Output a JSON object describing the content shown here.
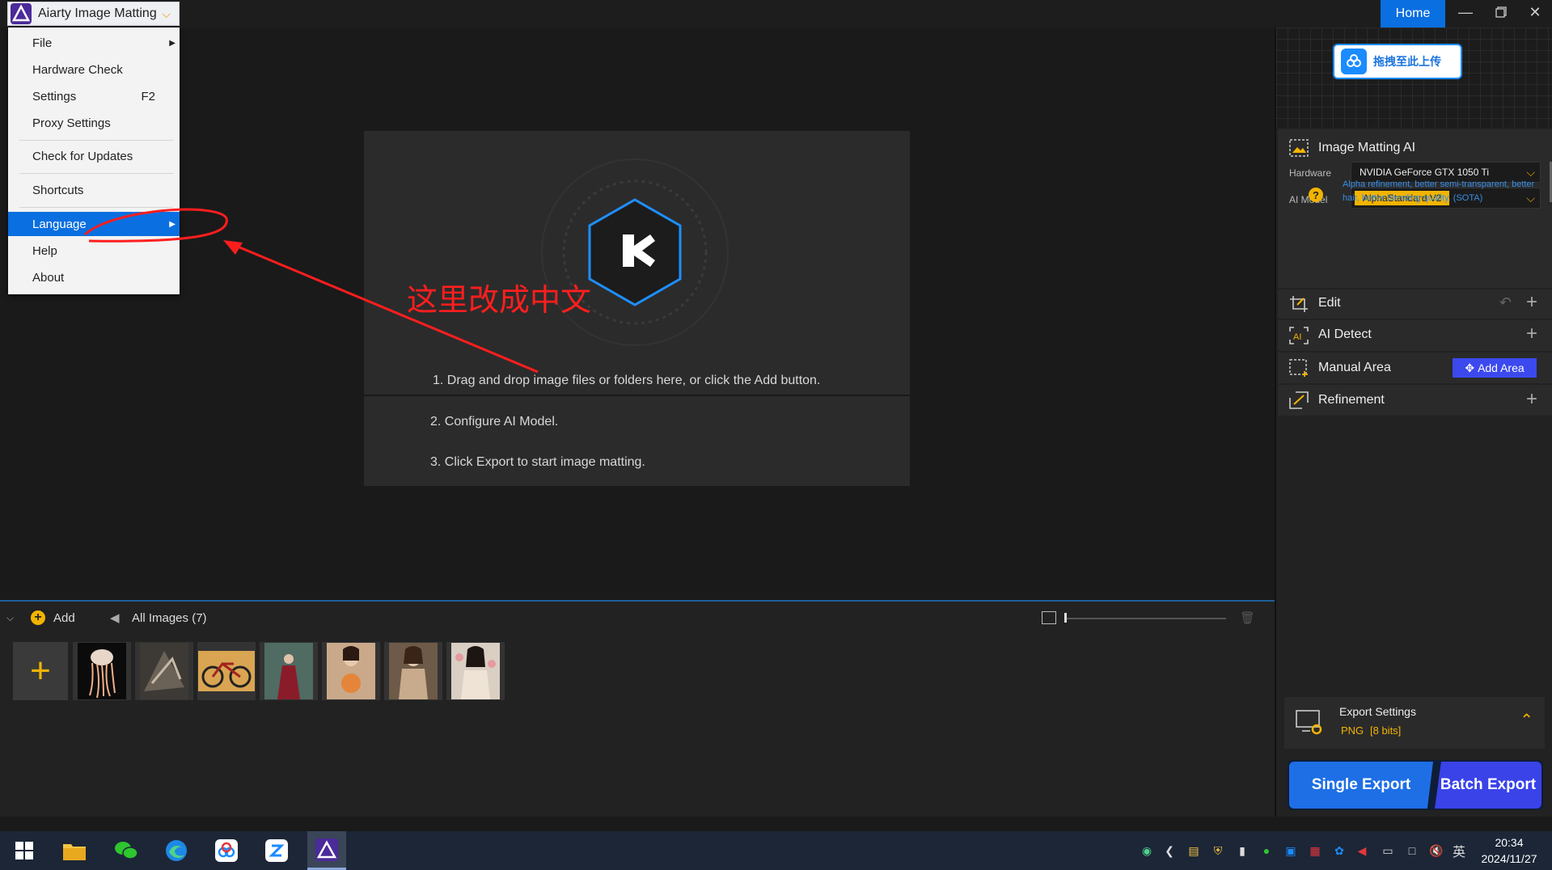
{
  "app": {
    "name": "Aiarty Image Matting",
    "home_label": "Home"
  },
  "menu": {
    "items": [
      {
        "label": "File",
        "submenu": true
      },
      {
        "label": "Hardware Check"
      },
      {
        "label": "Settings",
        "shortcut": "F2"
      },
      {
        "label": "Proxy Settings"
      },
      {
        "label": "Check for Updates"
      },
      {
        "label": "Shortcuts"
      },
      {
        "label": "Language",
        "submenu": true,
        "active": true
      },
      {
        "label": "Help"
      },
      {
        "label": "About"
      }
    ]
  },
  "annotation": {
    "text": "这里改成中文",
    "color": "#ff1e1e"
  },
  "stage": {
    "step1": "1. Drag and drop image files or folders here, or click the Add button.",
    "step2": "2. Configure AI Model.",
    "step3": "3. Click Export to start image matting."
  },
  "strip": {
    "add_label": "Add",
    "all_images_label": "All Images (7)",
    "thumbnails": [
      {
        "name": "jellyfish"
      },
      {
        "name": "dragon"
      },
      {
        "name": "bicycle"
      },
      {
        "name": "woman-forest"
      },
      {
        "name": "woman-flowers"
      },
      {
        "name": "woman-lace"
      },
      {
        "name": "woman-roses"
      }
    ]
  },
  "right_panel": {
    "upload_label": "拖拽至此上传",
    "image_matting": {
      "title": "Image Matting AI",
      "hardware_label": "Hardware",
      "hardware_value": "NVIDIA GeForce GTX 1050 Ti",
      "model_label": "AI Model",
      "model_value": "AlphaStandard  V2",
      "model_desc": "Alpha refinement, better semi-transparent, better hair, better blending quality. (SOTA)"
    },
    "edit_label": "Edit",
    "ai_detect_label": "AI Detect",
    "manual_area_label": "Manual Area",
    "add_area_label": "Add Area",
    "refinement_label": "Refinement",
    "export_settings": {
      "title": "Export Settings",
      "format": "PNG",
      "bits": "[8 bits]"
    },
    "single_export_label": "Single Export",
    "batch_export_label": "Batch Export"
  },
  "taskbar": {
    "time": "20:34",
    "date": "2024/11/27",
    "ime": "英"
  },
  "colors": {
    "accent_blue": "#0a6fe0",
    "accent_yellow": "#f2b400",
    "add_area_blue": "#3b49ee"
  }
}
